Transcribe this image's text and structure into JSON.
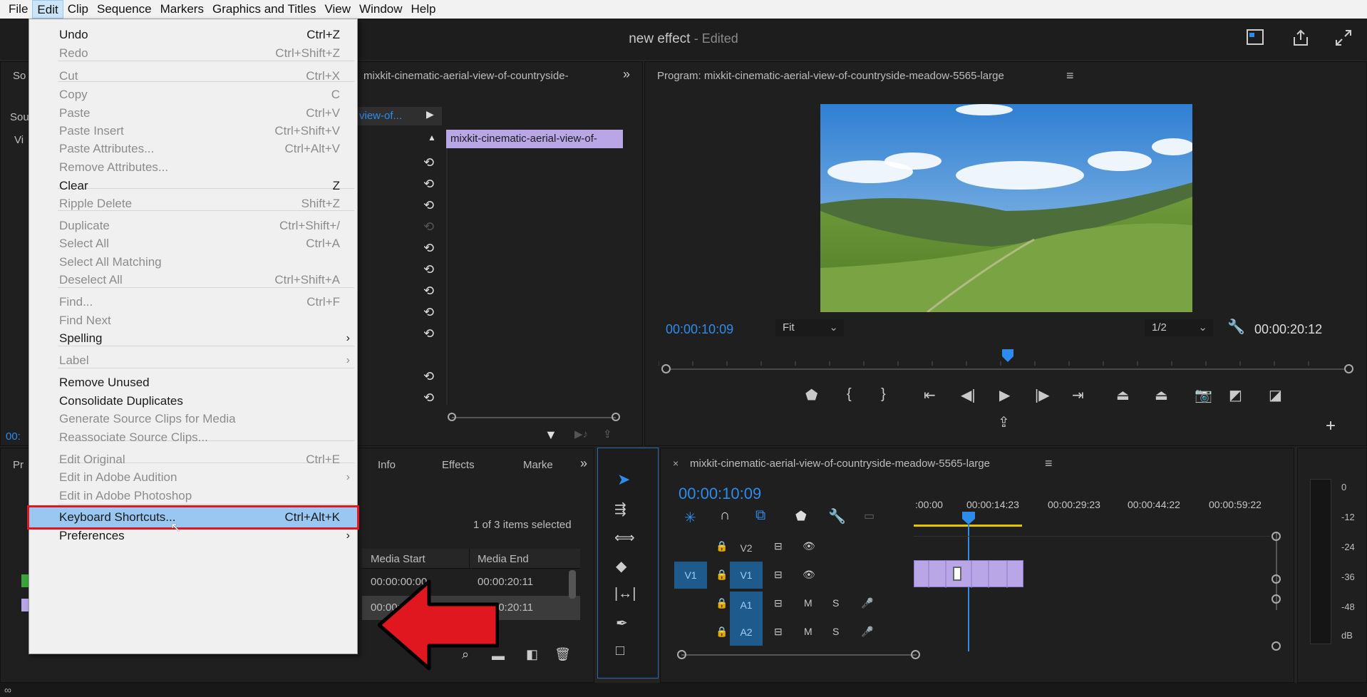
{
  "menubar": {
    "items": [
      "File",
      "Edit",
      "Clip",
      "Sequence",
      "Markers",
      "Graphics and Titles",
      "View",
      "Window",
      "Help"
    ],
    "active": "Edit"
  },
  "window": {
    "title": "new effect",
    "edited": "- Edited"
  },
  "edit_menu": {
    "items": [
      {
        "label": "Undo",
        "shortcut": "Ctrl+Z",
        "enabled": true
      },
      {
        "label": "Redo",
        "shortcut": "Ctrl+Shift+Z",
        "enabled": false
      },
      {
        "label": "Cut",
        "shortcut": "Ctrl+X",
        "enabled": false
      },
      {
        "label": "Copy",
        "shortcut": "C",
        "enabled": false
      },
      {
        "label": "Paste",
        "shortcut": "Ctrl+V",
        "enabled": false
      },
      {
        "label": "Paste Insert",
        "shortcut": "Ctrl+Shift+V",
        "enabled": false
      },
      {
        "label": "Paste Attributes...",
        "shortcut": "Ctrl+Alt+V",
        "enabled": false
      },
      {
        "label": "Remove Attributes...",
        "shortcut": "",
        "enabled": false
      },
      {
        "label": "Clear",
        "shortcut": "Z",
        "enabled": true
      },
      {
        "label": "Ripple Delete",
        "shortcut": "Shift+Z",
        "enabled": false
      },
      {
        "label": "Duplicate",
        "shortcut": "Ctrl+Shift+/",
        "enabled": false
      },
      {
        "label": "Select All",
        "shortcut": "Ctrl+A",
        "enabled": false
      },
      {
        "label": "Select All Matching",
        "shortcut": "",
        "enabled": false
      },
      {
        "label": "Deselect All",
        "shortcut": "Ctrl+Shift+A",
        "enabled": false
      },
      {
        "label": "Find...",
        "shortcut": "Ctrl+F",
        "enabled": false
      },
      {
        "label": "Find Next",
        "shortcut": "",
        "enabled": false
      },
      {
        "label": "Spelling",
        "shortcut": "",
        "enabled": true,
        "submenu": true
      },
      {
        "label": "Label",
        "shortcut": "",
        "enabled": false,
        "submenu": true
      },
      {
        "label": "Remove Unused",
        "shortcut": "",
        "enabled": true
      },
      {
        "label": "Consolidate Duplicates",
        "shortcut": "",
        "enabled": true
      },
      {
        "label": "Generate Source Clips for Media",
        "shortcut": "",
        "enabled": false
      },
      {
        "label": "Reassociate Source Clips...",
        "shortcut": "",
        "enabled": false
      },
      {
        "label": "Edit Original",
        "shortcut": "Ctrl+E",
        "enabled": false
      },
      {
        "label": "Edit in Adobe Audition",
        "shortcut": "",
        "enabled": false,
        "submenu": true
      },
      {
        "label": "Edit in Adobe Photoshop",
        "shortcut": "",
        "enabled": false
      },
      {
        "label": "Keyboard Shortcuts...",
        "shortcut": "Ctrl+Alt+K",
        "enabled": true,
        "highlighted": true
      },
      {
        "label": "Preferences",
        "shortcut": "",
        "enabled": true,
        "submenu": true
      }
    ]
  },
  "effects_panel": {
    "clip_title": "mixkit-cinematic-aerial-view-of-countryside-",
    "clip_tab": "view-of...",
    "timeline_clip": "mixkit-cinematic-aerial-view-of-",
    "left_tabs": [
      "So",
      "Sou",
      "Vi"
    ],
    "time_short": "00:"
  },
  "program_monitor": {
    "title": "Program: mixkit-cinematic-aerial-view-of-countryside-meadow-5565-large",
    "timecode": "00:00:10:09",
    "fit": "Fit",
    "resolution": "1/2",
    "duration": "00:00:20:12"
  },
  "project_panel": {
    "tabs": [
      "Pr",
      "Info",
      "Effects",
      "Marke"
    ],
    "selection": "1 of 3 items selected",
    "columns": [
      "Media Start",
      "Media End"
    ],
    "rows": [
      {
        "start": "00:00:00:00",
        "end": "00:00:20:11"
      },
      {
        "start": "00:00:00:00",
        "end": "00:00:20:11"
      }
    ]
  },
  "timeline": {
    "title": "mixkit-cinematic-aerial-view-of-countryside-meadow-5565-large",
    "timecode": "00:00:10:09",
    "ruler": [
      ":00:00",
      "00:00:14:23",
      "00:00:29:23",
      "00:00:44:22",
      "00:00:59:22"
    ],
    "tracks": [
      {
        "name": "V2",
        "type": "video"
      },
      {
        "name": "V1",
        "type": "video",
        "source": "V1"
      },
      {
        "name": "A1",
        "type": "audio",
        "m": "M",
        "s": "S"
      },
      {
        "name": "A2",
        "type": "audio",
        "m": "M",
        "s": "S"
      }
    ]
  },
  "audio_meter": {
    "labels": [
      "0",
      "-12",
      "-24",
      "-36",
      "-48",
      "dB"
    ]
  },
  "colors": {
    "accent_blue": "#2d8ceb",
    "clip_purple": "#b9a6e6",
    "highlight_red": "#e0171f"
  }
}
